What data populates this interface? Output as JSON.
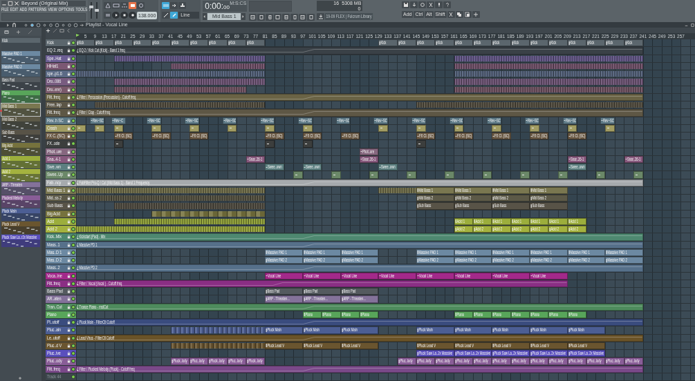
{
  "window": {
    "title": "Beyond (Original Mix)"
  },
  "menu": [
    "FILE",
    "EDIT",
    "ADD",
    "PATTERNS",
    "VIEW",
    "OPTIONS",
    "TOOLS",
    "?"
  ],
  "mixer_sliders": [
    {
      "level": 0.7
    },
    {
      "level": 0.5
    }
  ],
  "transport": {
    "tempo": "138.000",
    "time": "0:00:",
    "time_cs": "00",
    "time_unit": "M:S:CS",
    "pattern": "Mid Bass 1",
    "snap": "Line"
  },
  "monitor": {
    "polyphony": "16",
    "memory": "5308 MB",
    "cpu": "0"
  },
  "hint": "19-09 FLEX | Fulcrum Library",
  "toolbar": {
    "add": "Add",
    "keys": [
      "Ctrl",
      "Alt",
      "Shift"
    ]
  },
  "picker": [
    {
      "name": "Kick",
      "color": "#5b666d",
      "kind": "drum",
      "selected": false
    },
    {
      "name": "Massive PAD 1",
      "color": "#6c89a2",
      "kind": "notes",
      "selected": false
    },
    {
      "name": "Massive PAD 2",
      "color": "#6c89a2",
      "kind": "notes",
      "selected": false
    },
    {
      "name": "Bass Pad",
      "color": "#545a5f",
      "kind": "notes",
      "selected": false
    },
    {
      "name": "Piano",
      "color": "#58a55a",
      "kind": "notes",
      "selected": false
    },
    {
      "name": "Mid Bass 1",
      "color": "#7a7750",
      "kind": "notes",
      "selected": true
    },
    {
      "name": "Mid Bass 2",
      "color": "#5c5947",
      "kind": "notes",
      "selected": false
    },
    {
      "name": "Sub Bass",
      "color": "#585347",
      "kind": "notes",
      "selected": false
    },
    {
      "name": "Big Acid",
      "color": "#76723d",
      "kind": "notes",
      "selected": false
    },
    {
      "name": "Acid 1",
      "color": "#9cae3c",
      "kind": "notes",
      "selected": false
    },
    {
      "name": "Acid 2",
      "color": "#a4b23f",
      "kind": "notes",
      "selected": false
    },
    {
      "name": "ARP - Threaten",
      "color": "#84729a",
      "kind": "notes",
      "selected": false
    },
    {
      "name": "Plucked Melody",
      "color": "#895d97",
      "kind": "notes",
      "selected": false
    },
    {
      "name": "Pluck Main",
      "color": "#4c5e94",
      "kind": "notes",
      "selected": false
    },
    {
      "name": "Pluck Lead V",
      "color": "#6a552f",
      "kind": "notes",
      "selected": false
    },
    {
      "name": "Pluck Saw La..r2x Massive",
      "color": "#5a4fbd",
      "kind": "notes",
      "selected": false
    }
  ],
  "playlist": {
    "title": "Playlist - Vocal Line",
    "ruler": [
      "5",
      "9",
      "13",
      "17",
      "21",
      "25",
      "29",
      "33",
      "37",
      "41",
      "45",
      "49",
      "53",
      "57",
      "61",
      "65",
      "69",
      "73",
      "77",
      "81",
      "85",
      "89",
      "93",
      "97",
      "101",
      "105",
      "109",
      "113",
      "117",
      "121",
      "125",
      "129",
      "133",
      "137",
      "141",
      "145",
      "149",
      "153",
      "157",
      "161",
      "165",
      "169",
      "173",
      "177",
      "181",
      "185",
      "189",
      "193",
      "197",
      "201",
      "205",
      "209",
      "213",
      "217",
      "221",
      "225",
      "229",
      "233",
      "237",
      "241",
      "245",
      "249",
      "253",
      "257"
    ],
    "tracks": [
      {
        "name": "Kick",
        "color": "#5b666d",
        "clips": [
          {
            "kind": "pattern",
            "label": "Kick"
          },
          {
            "kind": "pattern",
            "label": "Kick"
          },
          {
            "kind": "pattern",
            "label": "Kick"
          },
          {
            "kind": "pattern",
            "label": "Kick"
          },
          {
            "kind": "pattern",
            "label": "Kick"
          },
          {
            "kind": "pattern",
            "label": "Kick"
          },
          {
            "kind": "pattern",
            "label": "Kick"
          },
          {
            "kind": "pattern",
            "label": "Kick"
          },
          {
            "kind": "pattern",
            "label": "Kick"
          },
          {
            "kind": "pattern",
            "label": "Kick"
          },
          {
            "kind": "pattern",
            "label": "Kick"
          },
          {
            "kind": "pattern",
            "label": "Kick"
          },
          {
            "kind": "pattern",
            "label": "Kick"
          },
          {
            "kind": "pattern",
            "label": "Kick"
          },
          {
            "kind": "pattern",
            "label": "Kick"
          },
          {
            "kind": "pattern",
            "label": "Kick"
          },
          {
            "kind": "pattern",
            "label": "Kick"
          },
          {
            "kind": "pattern",
            "label": "Kick"
          },
          {
            "kind": "pattern",
            "label": "Kick"
          },
          {
            "kind": "pattern",
            "label": "Kick"
          },
          {
            "kind": "pattern",
            "label": "Kick"
          },
          {
            "kind": "pattern",
            "label": "Kick"
          },
          {
            "kind": "pattern",
            "label": "Kick"
          },
          {
            "kind": "pattern",
            "label": "Kick"
          }
        ]
      },
      {
        "name": "EQ 2..req",
        "color": "#3a4147",
        "clips": [
          {
            "kind": "auto",
            "label": "EQ 2 / Kick Cut (Kick) - Band 1 freq"
          }
        ]
      },
      {
        "name": "Spe..Hat",
        "color": "#6c5e93",
        "clips": [
          {
            "kind": "run"
          },
          {
            "kind": "run"
          }
        ]
      },
      {
        "name": "HiHat1",
        "color": "#7b5873",
        "clips": [
          {
            "kind": "run"
          },
          {
            "kind": "run"
          }
        ]
      },
      {
        "name": "spe..p1.6",
        "color": "#5b6a85",
        "clips": [
          {
            "kind": "run"
          },
          {
            "kind": "run"
          }
        ]
      },
      {
        "name": "Dru..086",
        "color": "#785c80",
        "clips": [
          {
            "kind": "run"
          },
          {
            "kind": "run"
          }
        ]
      },
      {
        "name": "Dru..ere)",
        "color": "#7a5a6b",
        "clips": [
          {
            "kind": "run"
          },
          {
            "kind": "run"
          }
        ]
      },
      {
        "name": "Filt..freq",
        "color": "#6a6345",
        "clips": [
          {
            "kind": "auto",
            "label": "Filter / Percussion (Percussion) - Cutoff freq"
          }
        ]
      },
      {
        "name": "Free..lap",
        "color": "#5b5546",
        "clips": [
          {
            "kind": "run"
          },
          {
            "kind": "run"
          }
        ]
      },
      {
        "name": "Filt..freq",
        "color": "#5e5745",
        "clips": [
          {
            "kind": "auto",
            "label": "Filter / Clap - Cutoff freq"
          }
        ]
      },
      {
        "name": "Rev..h SC",
        "color": "#5d7986",
        "clips": [
          {
            "kind": "audio",
            "label": "Rev~SC"
          },
          {
            "kind": "audio",
            "label": "Rev~C"
          },
          {
            "kind": "audio",
            "label": "Rev~SC"
          },
          {
            "kind": "audio",
            "label": "Rev~SC"
          },
          {
            "kind": "audio",
            "label": "Rev~SC"
          },
          {
            "kind": "audio",
            "label": "Rev~SC"
          },
          {
            "kind": "audio",
            "label": "Rev~SC"
          },
          {
            "kind": "audio",
            "label": "Rev~SC"
          },
          {
            "kind": "audio",
            "label": "Rev~SC"
          },
          {
            "kind": "audio",
            "label": "Rev~SC"
          },
          {
            "kind": "audio",
            "label": "Rev~SC"
          },
          {
            "kind": "audio",
            "label": "Rev~SC"
          },
          {
            "kind": "audio",
            "label": "Rev~SC"
          },
          {
            "kind": "audio",
            "label": "Rev~SC"
          },
          {
            "kind": "audio",
            "label": "Rev~SC"
          }
        ]
      },
      {
        "name": "Crash",
        "color": "#a29d63",
        "clips": [
          {
            "kind": "audio"
          },
          {
            "kind": "audio"
          },
          {
            "kind": "audio"
          },
          {
            "kind": "audio"
          },
          {
            "kind": "audio"
          },
          {
            "kind": "audio"
          },
          {
            "kind": "audio"
          },
          {
            "kind": "audio"
          },
          {
            "kind": "audio"
          },
          {
            "kind": "audio"
          },
          {
            "kind": "audio"
          },
          {
            "kind": "audio"
          },
          {
            "kind": "audio"
          },
          {
            "kind": "audio"
          },
          {
            "kind": "audio"
          }
        ]
      },
      {
        "name": "FX C..(SC)",
        "color": "#6a5944",
        "clips": [
          {
            "kind": "audio",
            "label": "FX Cl. (SC)"
          },
          {
            "kind": "audio",
            "label": "FX Cl. (SC)"
          },
          {
            "kind": "audio",
            "label": "FX Cl. (SC)"
          },
          {
            "kind": "audio",
            "label": "FX Cl. (SC)"
          },
          {
            "kind": "audio",
            "label": "FX Cl. (SC)"
          },
          {
            "kind": "audio",
            "label": "FX Cl. (SC)"
          },
          {
            "kind": "audio",
            "label": "FX Cl. (SC)"
          },
          {
            "kind": "audio",
            "label": "FX Cl. (SC)"
          },
          {
            "kind": "audio",
            "label": "FX Cl. (SC)"
          },
          {
            "kind": "audio",
            "label": "FX Cl. (SC)"
          },
          {
            "kind": "audio",
            "label": "FX Cl. (SC)"
          }
        ]
      },
      {
        "name": "FX..ode",
        "color": "#3c3e3d",
        "clips": [
          {
            "kind": "audio"
          },
          {
            "kind": "audio"
          },
          {
            "kind": "audio"
          },
          {
            "kind": "audio"
          }
        ]
      },
      {
        "name": "Phot..ure",
        "color": "#86677f",
        "clips": [
          {
            "kind": "audio",
            "label": "Phot..ure"
          }
        ]
      },
      {
        "name": "Sna..4-1",
        "color": "#885a7e",
        "clips": [
          {
            "kind": "audio",
            "label": "Snar..26-1"
          },
          {
            "kind": "audio",
            "label": "Snar..26-1"
          },
          {
            "kind": "audio",
            "label": "Snar..26-1"
          },
          {
            "kind": "audio",
            "label": "Snar..26-1"
          }
        ]
      },
      {
        "name": "Swe..wn",
        "color": "#5c7f80",
        "clips": [
          {
            "kind": "audio",
            "label": "Swee..own"
          },
          {
            "kind": "audio",
            "label": "Swee..own"
          },
          {
            "kind": "audio",
            "label": "Swee..own"
          },
          {
            "kind": "audio",
            "label": "Swee..own"
          }
        ]
      },
      {
        "name": "Swee..Up",
        "color": "#6b8868",
        "clips": [
          {
            "kind": "audio"
          },
          {
            "kind": "audio"
          },
          {
            "kind": "audio"
          },
          {
            "kind": "audio"
          },
          {
            "kind": "audio"
          },
          {
            "kind": "audio"
          },
          {
            "kind": "audio"
          },
          {
            "kind": "audio"
          },
          {
            "kind": "audio"
          },
          {
            "kind": "audio"
          }
        ]
      },
      {
        "name": "Fab..ncy",
        "color": "#a6aaad",
        "clips": [
          {
            "kind": "auto",
            "label": "FabFilter Pro-Q / Cut (Mid Bass 1) - Band 1 Frequency"
          }
        ]
      },
      {
        "name": "Mid Bass 1",
        "color": "#7a7750",
        "clips": [
          {
            "kind": "run"
          },
          {
            "kind": "run"
          },
          {
            "kind": "pattern",
            "label": "Mid Bass 1"
          },
          {
            "kind": "pattern",
            "label": "Mid Bass 1"
          },
          {
            "kind": "pattern",
            "label": "Mid Bass 1"
          },
          {
            "kind": "pattern",
            "label": "Mid Bass 1"
          }
        ]
      },
      {
        "name": "Mid..ss 2",
        "color": "#5c5947",
        "clips": [
          {
            "kind": "run"
          },
          {
            "kind": "pattern",
            "label": "Mid Bass 2"
          },
          {
            "kind": "pattern",
            "label": "Mid Bass 2"
          },
          {
            "kind": "pattern",
            "label": "Mid Bass 2"
          },
          {
            "kind": "pattern",
            "label": "Mid Bass 2"
          }
        ]
      },
      {
        "name": "Sub Bass",
        "color": "#585347",
        "clips": [
          {
            "kind": "run"
          },
          {
            "kind": "pattern",
            "label": "Sub Bass"
          },
          {
            "kind": "pattern",
            "label": "Sub Bass"
          },
          {
            "kind": "pattern",
            "label": "Sub Bass"
          },
          {
            "kind": "pattern",
            "label": "Sub Bass"
          }
        ]
      },
      {
        "name": "Big Acid",
        "color": "#76723d",
        "clips": [
          {
            "kind": "run"
          }
        ]
      },
      {
        "name": "Acid",
        "color": "#9cae3c",
        "clips": [
          {
            "kind": "run"
          },
          {
            "kind": "pattern",
            "label": "Acid 1"
          },
          {
            "kind": "pattern",
            "label": "Acid 1"
          },
          {
            "kind": "pattern",
            "label": "Acid 1"
          },
          {
            "kind": "pattern",
            "label": "Acid 1"
          },
          {
            "kind": "pattern",
            "label": "Acid 1"
          },
          {
            "kind": "pattern",
            "label": "Acid 1"
          },
          {
            "kind": "pattern",
            "label": "Acid 1"
          }
        ]
      },
      {
        "name": "Acid 2",
        "color": "#a4b23f",
        "clips": [
          {
            "kind": "run"
          },
          {
            "kind": "pattern",
            "label": "Acid 2"
          },
          {
            "kind": "pattern",
            "label": "Acid 2"
          },
          {
            "kind": "pattern",
            "label": "Acid 2"
          },
          {
            "kind": "pattern",
            "label": "Acid 2"
          },
          {
            "kind": "pattern",
            "label": "Acid 2"
          },
          {
            "kind": "pattern",
            "label": "Acid 2"
          },
          {
            "kind": "pattern",
            "label": "Acid 2"
          }
        ]
      },
      {
        "name": "Kick..Mix",
        "color": "#4e8870",
        "clips": [
          {
            "kind": "auto",
            "label": "Kickstart (Pad) - Mix"
          }
        ]
      },
      {
        "name": "Mass..1",
        "color": "#56708a",
        "clips": [
          {
            "kind": "auto",
            "label": "Massive PD 1"
          }
        ]
      },
      {
        "name": "Mas..D 1",
        "color": "#6c89a2",
        "clips": [
          {
            "kind": "pattern",
            "label": "Massive PAD 1"
          },
          {
            "kind": "pattern",
            "label": "Massive PAD 1"
          },
          {
            "kind": "pattern",
            "label": "Massive PAD 1"
          },
          {
            "kind": "pattern",
            "label": "Massive PAD 1"
          },
          {
            "kind": "pattern",
            "label": "Massive PAD 1"
          },
          {
            "kind": "pattern",
            "label": "Massive PAD 1"
          },
          {
            "kind": "pattern",
            "label": "Massive PAD 1"
          },
          {
            "kind": "pattern",
            "label": "Massive PAD 1"
          },
          {
            "kind": "pattern",
            "label": "Massive PAD 1"
          }
        ]
      },
      {
        "name": "Mas..D 2",
        "color": "#6c89a2",
        "clips": [
          {
            "kind": "pattern",
            "label": "Massive PAD 2"
          },
          {
            "kind": "pattern",
            "label": "Massive PAD 2"
          },
          {
            "kind": "pattern",
            "label": "Massive PAD 2"
          },
          {
            "kind": "pattern",
            "label": "Massive PAD 2"
          },
          {
            "kind": "pattern",
            "label": "Massive PAD 2"
          },
          {
            "kind": "pattern",
            "label": "Massive PAD 2"
          },
          {
            "kind": "pattern",
            "label": "Massive PAD 2"
          },
          {
            "kind": "pattern",
            "label": "Massive PAD 2"
          },
          {
            "kind": "pattern",
            "label": "Massive PAD 2"
          }
        ]
      },
      {
        "name": "Mass..2",
        "color": "#56708a",
        "clips": [
          {
            "kind": "auto",
            "label": "Massive PD 2"
          }
        ]
      },
      {
        "name": "Voca..ine",
        "color": "#a3298a",
        "clips": [
          {
            "kind": "audio",
            "label": "Vocal Line"
          },
          {
            "kind": "audio",
            "label": "Vocal Line"
          },
          {
            "kind": "audio",
            "label": "Vocal Line"
          },
          {
            "kind": "audio",
            "label": "Vocal Line"
          },
          {
            "kind": "audio",
            "label": "Vocal Line"
          },
          {
            "kind": "audio",
            "label": "Vocal Line"
          },
          {
            "kind": "audio",
            "label": "Vocal Line"
          },
          {
            "kind": "audio",
            "label": "Vocal Line"
          }
        ]
      },
      {
        "name": "Filt..freq",
        "color": "#8a2e84",
        "clips": [
          {
            "kind": "auto",
            "label": "Filter / Vocal (Vocal ) - Cutoff freq"
          }
        ]
      },
      {
        "name": "Bass Pad",
        "color": "#545a5f",
        "clips": [
          {
            "kind": "pattern",
            "label": "Bass Pad"
          },
          {
            "kind": "pattern",
            "label": "Bass Pad"
          },
          {
            "kind": "pattern",
            "label": "Bass Pad"
          }
        ]
      },
      {
        "name": "AR..aten",
        "color": "#84729a",
        "clips": [
          {
            "kind": "pattern",
            "label": "ARP - Threaten..."
          },
          {
            "kind": "pattern",
            "label": "ARP - Threaten..."
          },
          {
            "kind": "pattern",
            "label": "ARP - Threaten..."
          }
        ]
      },
      {
        "name": "Tran..Cut",
        "color": "#4e8b5d",
        "clips": [
          {
            "kind": "auto",
            "label": "Trance Piano - mstCut"
          }
        ]
      },
      {
        "name": "Piano",
        "color": "#58a55a",
        "clips": [
          {
            "kind": "pattern",
            "label": "Piano"
          },
          {
            "kind": "pattern",
            "label": "Piano"
          },
          {
            "kind": "pattern",
            "label": "Piano"
          },
          {
            "kind": "pattern",
            "label": "Piano"
          },
          {
            "kind": "pattern",
            "label": "Piano"
          },
          {
            "kind": "pattern",
            "label": "Piano"
          },
          {
            "kind": "pattern",
            "label": "Piano"
          },
          {
            "kind": "pattern",
            "label": "Piano"
          },
          {
            "kind": "pattern",
            "label": "Piano"
          },
          {
            "kind": "pattern",
            "label": "Piano"
          },
          {
            "kind": "pattern",
            "label": "Piano"
          }
        ]
      },
      {
        "name": "Pl..utoff",
        "color": "#3a4c7e",
        "clips": [
          {
            "kind": "auto",
            "label": "Pluck Main - FilterCtl Cutoff"
          }
        ]
      },
      {
        "name": "Pluc..ain",
        "color": "#4c5e94",
        "clips": [
          {
            "kind": "run"
          },
          {
            "kind": "pattern",
            "label": "Pluck Main"
          },
          {
            "kind": "pattern",
            "label": "Pluck Main"
          },
          {
            "kind": "pattern",
            "label": "Pluck Main"
          },
          {
            "kind": "pattern",
            "label": "Pluck Main"
          },
          {
            "kind": "pattern",
            "label": "Pluck Main"
          },
          {
            "kind": "pattern",
            "label": "Pluck Main"
          },
          {
            "kind": "pattern",
            "label": "Pluck Main"
          },
          {
            "kind": "pattern",
            "label": "Pluck Main"
          }
        ]
      },
      {
        "name": "Le..utoff",
        "color": "#6a5328",
        "clips": [
          {
            "kind": "auto",
            "label": "Lead Virus - FilterCtl Cutoff"
          }
        ]
      },
      {
        "name": "Pluc..d V",
        "color": "#6a552f",
        "clips": [
          {
            "kind": "run"
          },
          {
            "kind": "pattern",
            "label": "Pluck Lead V"
          },
          {
            "kind": "pattern",
            "label": "Pluck Lead V"
          },
          {
            "kind": "pattern",
            "label": "Pluck Lead V"
          },
          {
            "kind": "pattern",
            "label": "Pluck Lead V"
          },
          {
            "kind": "pattern",
            "label": "Pluck Lead V"
          },
          {
            "kind": "pattern",
            "label": "Pluck Lead V"
          },
          {
            "kind": "pattern",
            "label": "Pluck Lead V"
          },
          {
            "kind": "pattern",
            "label": "Pluck Lead V"
          }
        ]
      },
      {
        "name": "Pluc..ive",
        "color": "#5a4fbd",
        "clips": [
          {
            "kind": "pattern",
            "label": "Pluck Saw La..2x Massive"
          },
          {
            "kind": "pattern",
            "label": "Pluck Saw La..2x Massive"
          },
          {
            "kind": "pattern",
            "label": "Pluck Saw La..2x Massive"
          },
          {
            "kind": "pattern",
            "label": "Pluck Saw La..2x Massive"
          },
          {
            "kind": "pattern",
            "label": "Pluck Saw La..2x Massive"
          }
        ]
      },
      {
        "name": "Pluc..ody",
        "color": "#895d97",
        "clips": [
          {
            "kind": "pattern",
            "label": "Pluck..lody"
          },
          {
            "kind": "pattern",
            "label": "Pluc..lody"
          },
          {
            "kind": "pattern",
            "label": "Pluck..lody"
          },
          {
            "kind": "pattern",
            "label": "Pluc..lody"
          },
          {
            "kind": "pattern",
            "label": "Pluck..lody"
          },
          {
            "kind": "pattern",
            "label": "Pluc..lody"
          },
          {
            "kind": "pattern",
            "label": "Pluc..lody"
          },
          {
            "kind": "pattern",
            "label": "Pluc..lody"
          },
          {
            "kind": "pattern",
            "label": "Pluc..lody"
          },
          {
            "kind": "pattern",
            "label": "Pluc..lody"
          },
          {
            "kind": "pattern",
            "label": "Pluc..lody"
          },
          {
            "kind": "pattern",
            "label": "Pluc..lody"
          },
          {
            "kind": "pattern",
            "label": "Pluc..lody"
          },
          {
            "kind": "pattern",
            "label": "Pluc..lody"
          },
          {
            "kind": "pattern",
            "label": "Pluc..lody"
          },
          {
            "kind": "pattern",
            "label": "Pluc..lody"
          },
          {
            "kind": "pattern",
            "label": "Pluc..lody"
          },
          {
            "kind": "pattern",
            "label": "Pluc..lody"
          }
        ]
      },
      {
        "name": "Filt..freq",
        "color": "#7a4989",
        "clips": [
          {
            "kind": "auto",
            "label": "Filter / Plucked Melody (Pluck) - Cutoff freq"
          }
        ]
      },
      {
        "name": "Track 44",
        "color": "#3d464c"
      }
    ]
  }
}
